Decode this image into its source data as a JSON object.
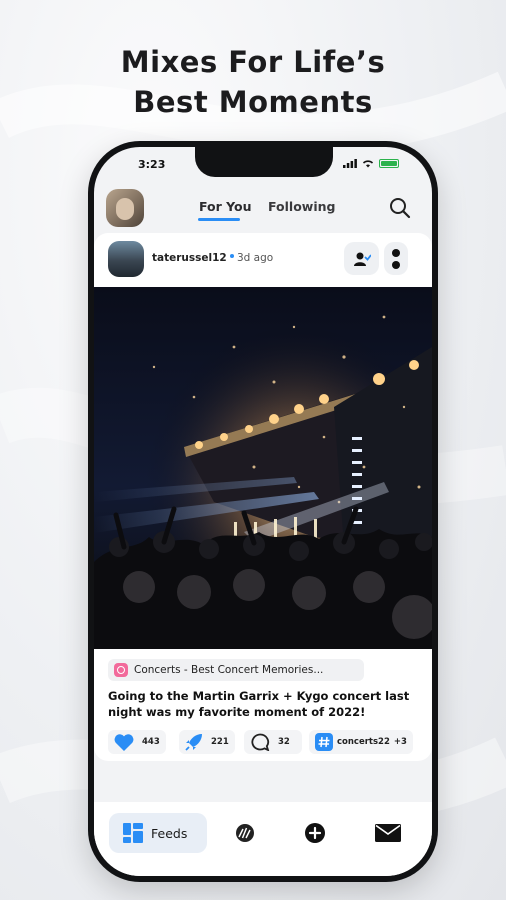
{
  "headline": {
    "line1": "Mixes For Life’s",
    "line2": "Best Moments"
  },
  "status_bar": {
    "time": "3:23"
  },
  "top_bar": {
    "tabs": [
      {
        "label": "For You",
        "active": true
      },
      {
        "label": "Following",
        "active": false
      }
    ]
  },
  "post": {
    "author": "taterussel12",
    "time": "3d ago",
    "community": "Concerts - Best Concert Memories...",
    "caption": "Going to the Martin Garrix + Kygo concert last night was my favorite moment of 2022!",
    "likes": "443",
    "boosts": "221",
    "comments": "32",
    "tag": "concerts22",
    "tag_more": "+3"
  },
  "bottom_nav": {
    "items": [
      {
        "label": "Feeds",
        "icon": "feeds-icon",
        "active": true
      },
      {
        "label": "",
        "icon": "discover-icon",
        "active": false
      },
      {
        "label": "",
        "icon": "add-icon",
        "active": false
      },
      {
        "label": "",
        "icon": "mail-icon",
        "active": false
      }
    ]
  },
  "colors": {
    "accent": "#2a8df5",
    "like": "#2a8df5",
    "chip_icon": "#f26a9b",
    "battery": "#2bb24c"
  }
}
